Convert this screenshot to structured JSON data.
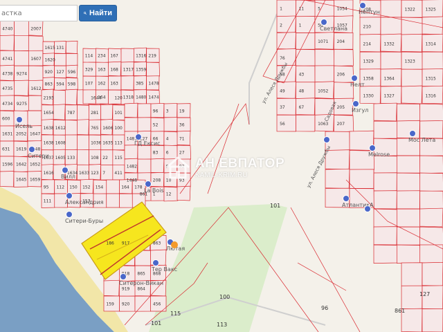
{
  "search": {
    "placeholder": "астка",
    "button_label": "Найти"
  },
  "watermark": {
    "title": "АН ЕВПАТОР",
    "url": "KAMIL-KRIM.RU"
  },
  "colors": {
    "parcel_border": "#d9272e",
    "parcel_fill": "#f6e8e8",
    "highlight": "#f6e61e",
    "water": "#7a9fc4",
    "beach": "#f2e6a8",
    "green": "#d8ecc8",
    "button": "#2f6fb6"
  },
  "map": {
    "pois": [
      "Исель",
      "Ситери",
      "Вилл",
      "Александрия",
      "Ситери-Буры",
      "Ситерон-Викан",
      "La Bois",
      "Тер Вакс",
      "Лютая",
      "ГД Ексис",
      "Светлана",
      "Нептун",
      "Нелт",
      "Изгул",
      "Мос Лета",
      "Melrose",
      "АтлантикА"
    ],
    "roads": [
      "ул. Алеся Дружбы",
      "ул. Алеся Дружбы",
      "Садовая"
    ],
    "parcels": [
      "4740",
      "4741",
      "4738",
      "4735",
      "4734",
      "9274",
      "9275",
      "2007",
      "1607",
      "1612",
      "1615",
      "1620",
      "920",
      "863",
      "131",
      "127",
      "594",
      "596",
      "598",
      "600",
      "1631",
      "631",
      "1596",
      "2052",
      "1619",
      "1642",
      "1645",
      "1647",
      "1648",
      "1652",
      "1659",
      "2193",
      "1654",
      "1638",
      "1638",
      "1637",
      "1616",
      "1612",
      "1608",
      "1605",
      "787",
      "133",
      "1634",
      "1633",
      "1644",
      "281",
      "765",
      "1036",
      "108",
      "123",
      "1606",
      "1635",
      "22",
      "7",
      "120",
      "101",
      "100",
      "113",
      "115",
      "411",
      "114",
      "329",
      "107",
      "234",
      "163",
      "162",
      "164",
      "167",
      "168",
      "163",
      "1317",
      "1318",
      "1316",
      "1359",
      "385",
      "1480",
      "219",
      "1478",
      "1474",
      "1481",
      "1482",
      "1448",
      "127",
      "861",
      "96",
      "52",
      "66",
      "83",
      "208",
      "1",
      "3",
      "4",
      "6",
      "9",
      "10",
      "12",
      "19",
      "36",
      "71",
      "27",
      "92",
      "93",
      "95",
      "111",
      "112",
      "150",
      "152",
      "153",
      "154",
      "164",
      "178",
      "186",
      "159",
      "917",
      "918",
      "919",
      "920",
      "865",
      "864",
      "863",
      "868",
      "456",
      "1",
      "2",
      "76",
      "58",
      "49",
      "37",
      "56",
      "11",
      "1",
      "43",
      "48",
      "67",
      "5",
      "50",
      "1071",
      "1052",
      "1063",
      "1054",
      "1057",
      "204",
      "206",
      "205",
      "207",
      "208",
      "210",
      "214",
      "1329",
      "1358",
      "1330",
      "1332",
      "1364",
      "1327",
      "1322",
      "1323",
      "1325",
      "1314",
      "1315",
      "1316"
    ]
  }
}
